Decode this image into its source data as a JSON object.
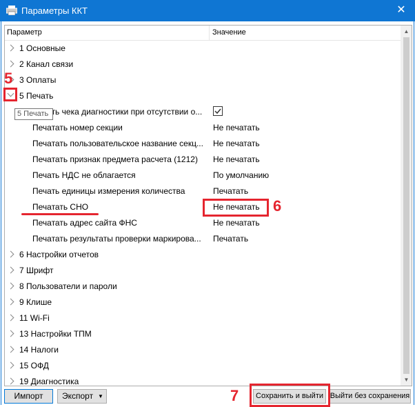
{
  "window": {
    "title": "Параметры ККТ",
    "close_glyph": "✕"
  },
  "table": {
    "header": {
      "col1": "Параметр",
      "col2": "Значение"
    },
    "rows": [
      {
        "label": "1 Основные",
        "expandable": true,
        "expanded": false
      },
      {
        "label": "2 Канал связи",
        "expandable": true,
        "expanded": false
      },
      {
        "label": "3 Оплаты",
        "expandable": true,
        "expanded": false
      },
      {
        "label": "5 Печать",
        "expandable": true,
        "expanded": true
      },
      {
        "label": "Печать чека диагностики при отсутствии о...",
        "value_checkbox": true
      },
      {
        "label": "Печатать номер секции",
        "value": "Не печатать"
      },
      {
        "label": "Печатать пользовательское название секц...",
        "value": "Не печатать"
      },
      {
        "label": "Печатать признак предмета расчета (1212)",
        "value": "Не печатать"
      },
      {
        "label": "Печать НДС не облагается",
        "value": "По умолчанию"
      },
      {
        "label": "Печать единицы измерения количества",
        "value": "Печатать"
      },
      {
        "label": "Печатать СНО",
        "value": "Не печатать"
      },
      {
        "label": "Печатать адрес сайта ФНС",
        "value": "Не печатать"
      },
      {
        "label": "Печатать результаты проверки маркирова...",
        "value": "Печатать"
      },
      {
        "label": "6 Настройки отчетов",
        "expandable": true,
        "expanded": false
      },
      {
        "label": "7 Шрифт",
        "expandable": true,
        "expanded": false
      },
      {
        "label": "8 Пользователи и пароли",
        "expandable": true,
        "expanded": false
      },
      {
        "label": "9 Клише",
        "expandable": true,
        "expanded": false
      },
      {
        "label": "11 Wi-Fi",
        "expandable": true,
        "expanded": false
      },
      {
        "label": "13 Настройки ТПМ",
        "expandable": true,
        "expanded": false
      },
      {
        "label": "14 Налоги",
        "expandable": true,
        "expanded": false
      },
      {
        "label": "15 ОФД",
        "expandable": true,
        "expanded": false
      },
      {
        "label": "19 Диагностика",
        "expandable": true,
        "expanded": false
      }
    ]
  },
  "tooltip": {
    "text": "5 Печать"
  },
  "buttons": {
    "import": "Импорт",
    "export": "Экспорт",
    "export_arrow": "▼",
    "save_exit": "Сохранить и выйти",
    "exit_no_save": "Выйти без сохранения"
  },
  "annotations": {
    "n5": "5",
    "n6": "6",
    "n7": "7",
    "color": "#e5252f"
  },
  "icons": {
    "app": "printer-icon",
    "close": "close-icon",
    "expand": "chevron-right-icon",
    "collapse": "chevron-down-icon",
    "checkbox": "checkmark-icon"
  }
}
